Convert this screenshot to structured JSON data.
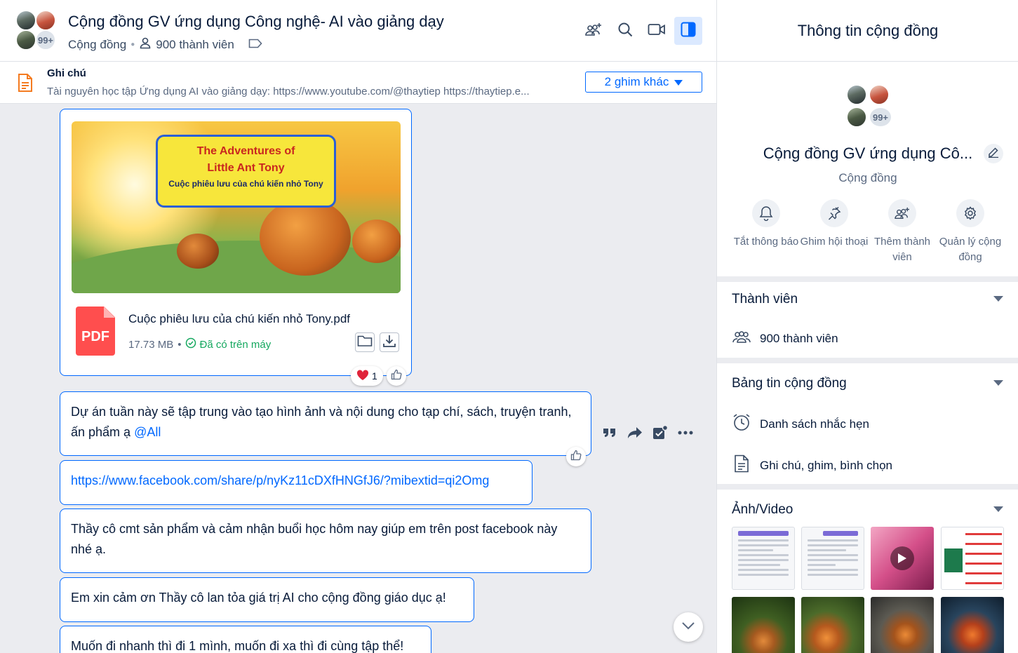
{
  "conversation": {
    "title": "Cộng đồng GV ứng dụng Công nghệ- AI vào giảng dạy",
    "type_label": "Cộng đồng",
    "member_count_label": "900 thành viên",
    "avatar_overflow": "99+"
  },
  "note_bar": {
    "title": "Ghi chú",
    "text": "Tài nguyên học tập Ứng dụng AI vào giảng dạy: https://www.youtube.com/@thaytiep https://thaytiep.e...",
    "pins_button": "2 ghim khác"
  },
  "file_message": {
    "thumbnail": {
      "line1": "The Adventures of",
      "line2": "Little Ant Tony",
      "line3": "Cuộc phiêu lưu của chú kiến nhỏ Tony"
    },
    "file_type": "PDF",
    "file_name": "Cuộc phiêu lưu của chú kiến nhỏ Tony.pdf",
    "file_size": "17.73 MB",
    "status": "Đã có trên máy",
    "reaction_count": "1"
  },
  "messages": [
    {
      "text": "Dự án tuần này sẽ tập trung vào tạo hình ảnh và nội dung cho tạp chí, sách, truyện tranh, ấn phẩm ạ",
      "mention": "@All"
    },
    {
      "link": "https://www.facebook.com/share/p/nyKz11cDXfHNGfJ6/?mibextid=qi2Omg"
    },
    {
      "text": "Thầy cô cmt sản phẩm và cảm nhận buổi học hôm nay giúp em trên post facebook này nhé ạ."
    },
    {
      "text": "Em xin cảm ơn Thầy cô lan tỏa giá trị AI cho cộng đồng giáo dục ạ!"
    },
    {
      "text": "Muốn đi nhanh thì đi 1 mình, muốn đi xa thì đi cùng tập thể!"
    }
  ],
  "info_panel": {
    "header": "Thông tin cộng đồng",
    "name": "Cộng đồng GV ứng dụng Cô...",
    "type": "Cộng đồng",
    "avatar_overflow": "99+",
    "quick_actions": [
      {
        "label": "Tắt thông báo",
        "icon": "bell-icon"
      },
      {
        "label": "Ghim hội thoại",
        "icon": "pin-icon"
      },
      {
        "label": "Thêm thành viên",
        "icon": "add-member-icon"
      },
      {
        "label": "Quản lý cộng đồng",
        "icon": "gear-icon"
      }
    ],
    "members_section": {
      "title": "Thành viên",
      "count_label": "900 thành viên"
    },
    "board_section": {
      "title": "Bảng tin cộng đồng",
      "reminders": "Danh sách nhắc hẹn",
      "notes": "Ghi chú, ghim, bình chọn"
    },
    "media_section": {
      "title": "Ảnh/Video"
    }
  },
  "colors": {
    "accent": "#0068ff",
    "text": "#081b3a",
    "muted": "#5a6981",
    "success": "#15a85f",
    "pdf": "#ff4e4e"
  }
}
